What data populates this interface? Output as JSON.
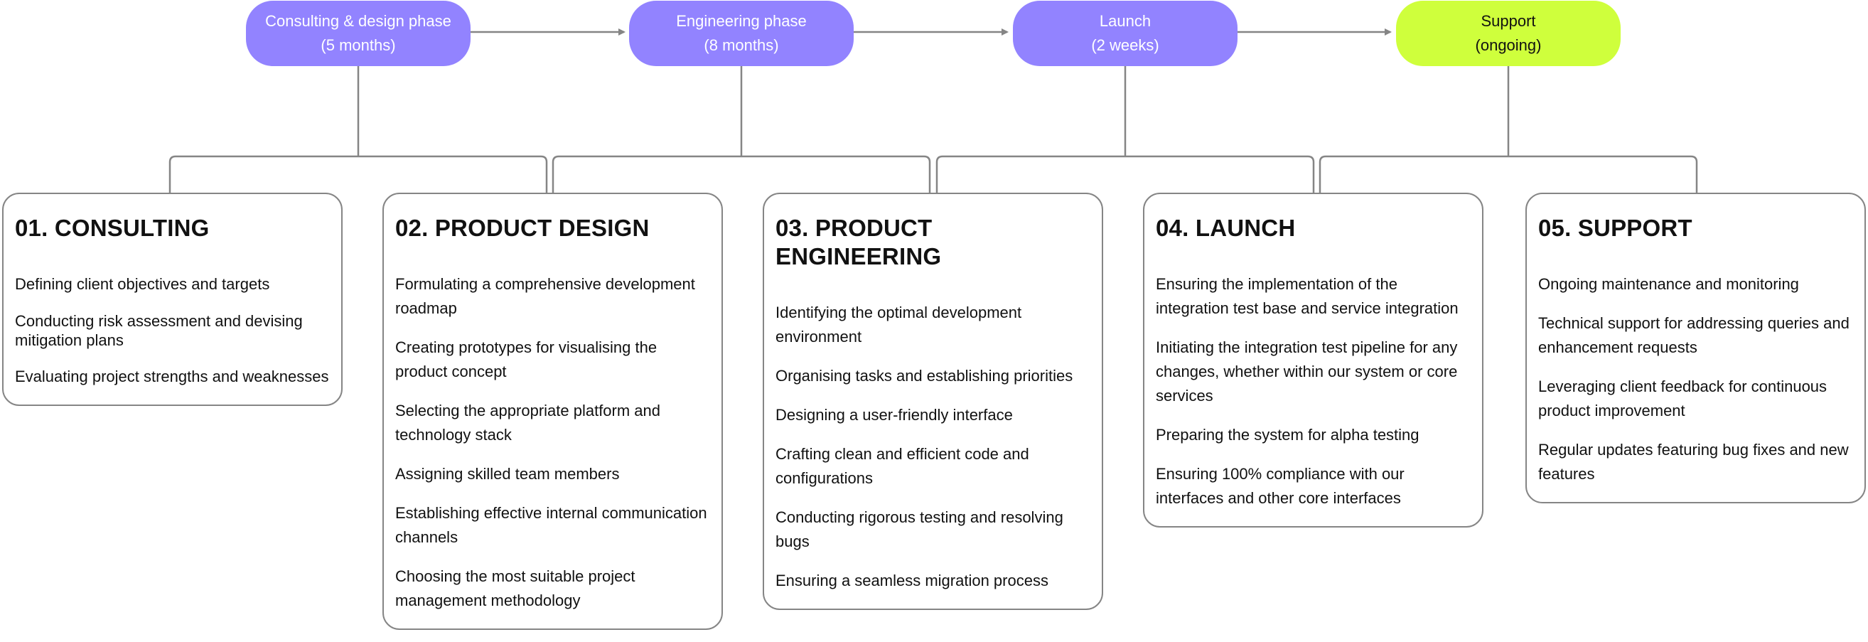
{
  "phases": [
    {
      "name": "Consulting & design phase",
      "duration": "(5 months)",
      "color": "#9283ff"
    },
    {
      "name": "Engineering phase",
      "duration": "(8 months)",
      "color": "#9283ff"
    },
    {
      "name": "Launch",
      "duration": "(2 weeks)",
      "color": "#9283ff"
    },
    {
      "name": "Support",
      "duration": "(ongoing)",
      "color": "#cfff3c"
    }
  ],
  "stages": [
    {
      "title": "01. CONSULTING",
      "items": [
        "Defining client objectives and targets",
        "Conducting risk assessment and devising mitigation plans",
        "Evaluating project strengths and weaknesses"
      ]
    },
    {
      "title": "02. PRODUCT DESIGN",
      "items": [
        "Formulating a comprehensive development roadmap",
        "Creating prototypes for visualising the product concept",
        "Selecting the appropriate platform and technology stack",
        "Assigning skilled team members",
        "Establishing effective internal communication channels",
        "Choosing the most suitable project management methodology"
      ]
    },
    {
      "title": "03. PRODUCT ENGINEERING",
      "items": [
        "Identifying the optimal development environment",
        "Organising tasks and establishing priorities",
        "Designing a user-friendly interface",
        "Crafting clean and efficient code and configurations",
        "Conducting rigorous testing and resolving bugs",
        "Ensuring a seamless migration process"
      ]
    },
    {
      "title": "04. LAUNCH",
      "items": [
        "Ensuring the implementation of the integration test base and service integration",
        "Initiating the integration test pipeline for any changes, whether within our system or core services",
        "Preparing the system for alpha testing",
        "Ensuring 100% compliance with our interfaces and other core interfaces"
      ]
    },
    {
      "title": "05. SUPPORT",
      "items": [
        "Ongoing maintenance and monitoring",
        "Technical support for addressing queries and enhancement requests",
        "Leveraging client feedback for continuous product improvement",
        "Regular updates featuring bug fixes and new features"
      ]
    }
  ],
  "colors": {
    "phase_accent": "#9283ff",
    "support_accent": "#cfff3c",
    "connector": "#858585"
  }
}
